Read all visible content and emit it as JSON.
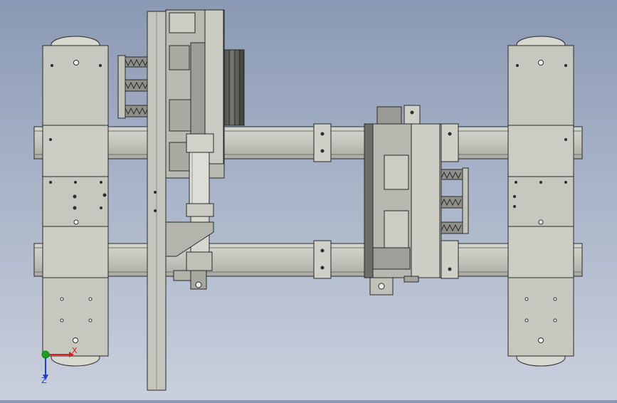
{
  "viewport": {
    "background_top": "#8a99b3",
    "background_bottom": "#c9cfdc",
    "part_fill": "#c3c4bc",
    "part_stroke": "#2a2a2a",
    "dark_fill": "#5d5e59"
  },
  "triad": {
    "x_label": "X",
    "z_label": "Z",
    "x_color": "#d42020",
    "y_color": "#20a020",
    "z_color": "#2040c8"
  }
}
